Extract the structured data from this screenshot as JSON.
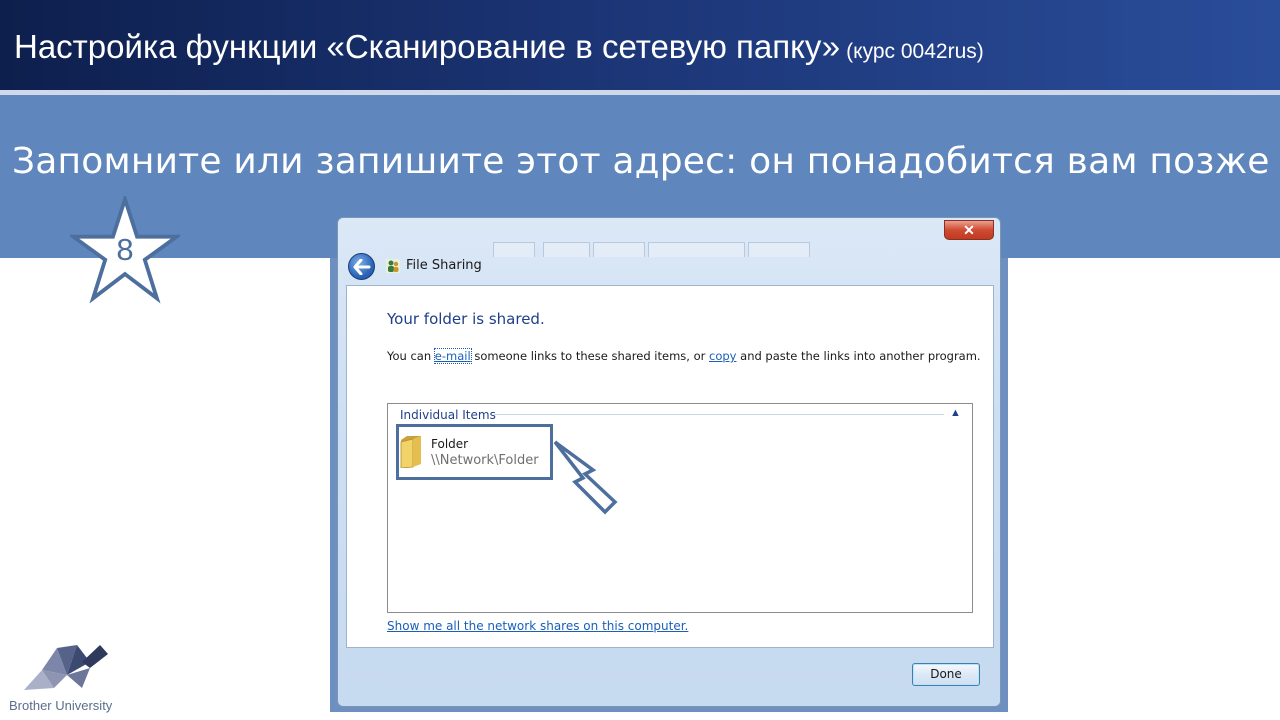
{
  "header": {
    "title": "Настройка функции «Сканирование в сетевую папку»",
    "subtitle": "(курс 0042rus)"
  },
  "instruction": "Запомните или запишите этот адрес: он понадобится вам позже",
  "step_number": "8",
  "logo": {
    "text": "Brother University"
  },
  "dialog": {
    "title": "File Sharing",
    "close_label": "✕",
    "heading": "Your folder is shared.",
    "description": {
      "prefix": "You can",
      "email_link": "e-mail",
      "middle": "someone links to these shared items, or",
      "copy_link": "copy",
      "suffix": "and paste the links into another program."
    },
    "group_label": "Individual Items",
    "items": [
      {
        "name": "Folder",
        "path": "\\\\Network\\Folder"
      }
    ],
    "show_shares_link": "Show me all the network shares on this computer.",
    "done_label": "Done"
  },
  "colors": {
    "header_bg": "#1b3474",
    "band_bg": "#5f86bd",
    "accent": "#4d6f9e",
    "link": "#1a5fb8"
  }
}
